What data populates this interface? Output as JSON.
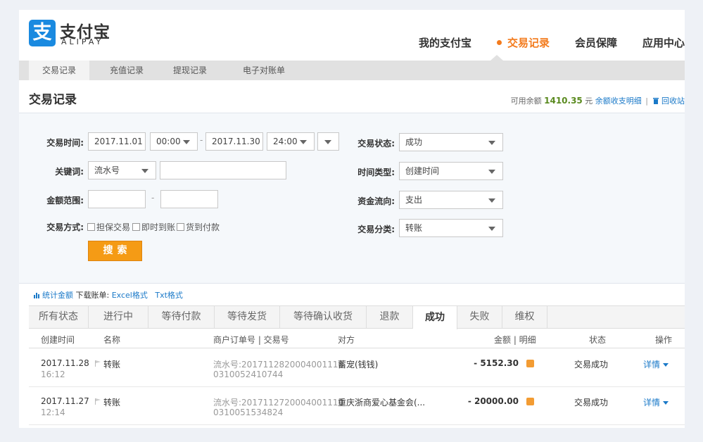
{
  "brand": {
    "cn": "支付宝",
    "en": "ALIPAY",
    "mark": "支"
  },
  "topnav": [
    "我的支付宝",
    "交易记录",
    "会员保障",
    "应用中心"
  ],
  "subnav": [
    "交易记录",
    "充值记录",
    "提现记录",
    "电子对账单"
  ],
  "page_title": "交易记录",
  "balance": {
    "label": "可用余额",
    "amount": "1410.35",
    "unit": "元",
    "link_detail": "余额收支明细",
    "sep": "|",
    "link_recycle": "回收站"
  },
  "filter": {
    "time_label": "交易时间:",
    "date_from": "2017.11.01",
    "time_from": "00:00",
    "dash": "-",
    "date_to": "2017.11.30",
    "time_to": "24:00",
    "keyword_label": "关键词:",
    "keyword_type": "流水号",
    "keyword_value": "",
    "amount_label": "金额范围:",
    "amount_min": "",
    "amount_max": "",
    "method_label": "交易方式:",
    "methods": [
      "担保交易",
      "即时到账",
      "货到付款"
    ],
    "status_label": "交易状态:",
    "status_value": "成功",
    "timetype_label": "时间类型:",
    "timetype_value": "创建时间",
    "flow_label": "资金流向:",
    "flow_value": "支出",
    "category_label": "交易分类:",
    "category_value": "转账",
    "search_button": "搜索"
  },
  "tools": {
    "stats_link": "统计金额",
    "download_label": "下载账单:",
    "excel": "Excel格式",
    "txt": "Txt格式"
  },
  "status_tabs": [
    "所有状态",
    "进行中",
    "等待付款",
    "等待发货",
    "等待确认收货",
    "退款",
    "成功",
    "失败",
    "维权"
  ],
  "table": {
    "headers": {
      "created": "创建时间",
      "name": "名称",
      "order": "商户订单号 | 交易号",
      "party": "对方",
      "amount": "金额 | 明细",
      "status": "状态",
      "action": "操作"
    },
    "rows": [
      {
        "date": "2017.11.28",
        "time": "16:12",
        "name": "转账",
        "serial_line1": "流水号:2017112820004001110",
        "serial_line2": "0310052410744",
        "party": "蓄宠(钱钱)",
        "amount": "- 5152.30",
        "status": "交易成功",
        "action": "详情"
      },
      {
        "date": "2017.11.27",
        "time": "12:14",
        "name": "转账",
        "serial_line1": "流水号:2017112720004001110",
        "serial_line2": "0310051534824",
        "party": "重庆浙商爱心基金会(...",
        "amount": "- 20000.00",
        "status": "交易成功",
        "action": "详情"
      }
    ]
  },
  "colors": {
    "accent": "#f37b1d",
    "link": "#1a79c8",
    "brand_blue": "#1a8ae0",
    "button": "#f59b15"
  }
}
